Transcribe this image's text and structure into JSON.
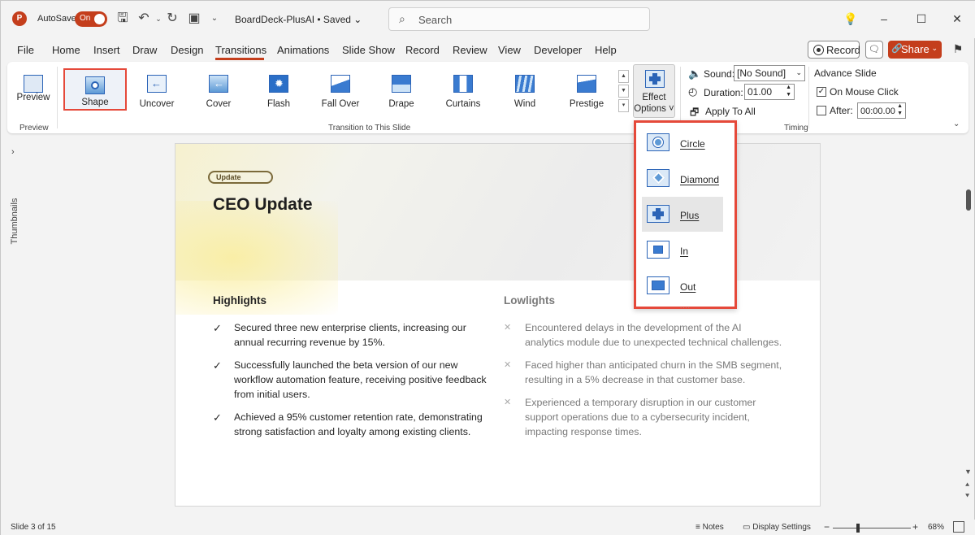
{
  "window": {
    "autosave_label": "AutoSave",
    "autosave_state": "On",
    "doc_title": "BoardDeck-PlusAI • Saved ⌄",
    "search_placeholder": "Search"
  },
  "menu": {
    "tabs": [
      "File",
      "Home",
      "Insert",
      "Draw",
      "Design",
      "Transitions",
      "Animations",
      "Slide Show",
      "Record",
      "Review",
      "View",
      "Developer",
      "Help"
    ],
    "active_tab": "Transitions",
    "record_label": "Record",
    "share_label": "Share"
  },
  "ribbon": {
    "preview_label": "Preview",
    "preview_group": "Preview",
    "transition_group": "Transition to This Slide",
    "transitions": [
      "Shape",
      "Uncover",
      "Cover",
      "Flash",
      "Fall Over",
      "Drape",
      "Curtains",
      "Wind",
      "Prestige"
    ],
    "selected_transition": "Shape",
    "effect_options_line1": "Effect",
    "effect_options_line2": "Options ˅",
    "sound_label": "Sound:",
    "sound_value": "[No Sound]",
    "duration_label": "Duration:",
    "duration_value": "01.00",
    "apply_all_label": "Apply To All",
    "advance_slide_label": "Advance Slide",
    "on_mouse_click_label": "On Mouse Click",
    "on_mouse_click_checked": true,
    "after_label": "After:",
    "after_value": "00:00.00",
    "after_checked": false,
    "timing_group": "Timing"
  },
  "effect_dropdown": {
    "items": [
      "Circle",
      "Diamond",
      "Plus",
      "In",
      "Out"
    ],
    "highlighted": "Plus"
  },
  "sidebar": {
    "thumbnails_label": "Thumbnails"
  },
  "slide": {
    "tag": "Update",
    "title": "CEO Update",
    "highlights_title": "Highlights",
    "highlights": [
      [
        "Secured three new enterprise clients, increasing our",
        "annual recurring revenue by 15%."
      ],
      [
        "Successfully launched the beta version of our new",
        "workflow automation feature, receiving positive feedback",
        "from initial users."
      ],
      [
        "Achieved a 95% customer retention rate, demonstrating",
        "strong satisfaction and loyalty among existing clients."
      ]
    ],
    "lowlights_title": "Lowlights",
    "lowlights": [
      [
        "Encountered delays in the development of the AI",
        "analytics module due to unexpected technical challenges."
      ],
      [
        "Faced higher than anticipated churn in the SMB segment,",
        "resulting in a 5% decrease in that customer base."
      ],
      [
        "Experienced a temporary disruption in our customer",
        "support operations due to a cybersecurity incident,",
        "impacting response times."
      ]
    ],
    "check_mark": "✓",
    "cross_mark": "✕"
  },
  "status": {
    "slide_info": "Slide 3 of 15",
    "notes_label": "Notes",
    "display_settings_label": "Display Settings",
    "zoom_minus": "−",
    "zoom_plus": "+",
    "zoom_level": "68%"
  },
  "colors": {
    "accent": "#c43e1c",
    "highlight_border": "#e5493a",
    "icon_blue": "#2b64b7"
  }
}
